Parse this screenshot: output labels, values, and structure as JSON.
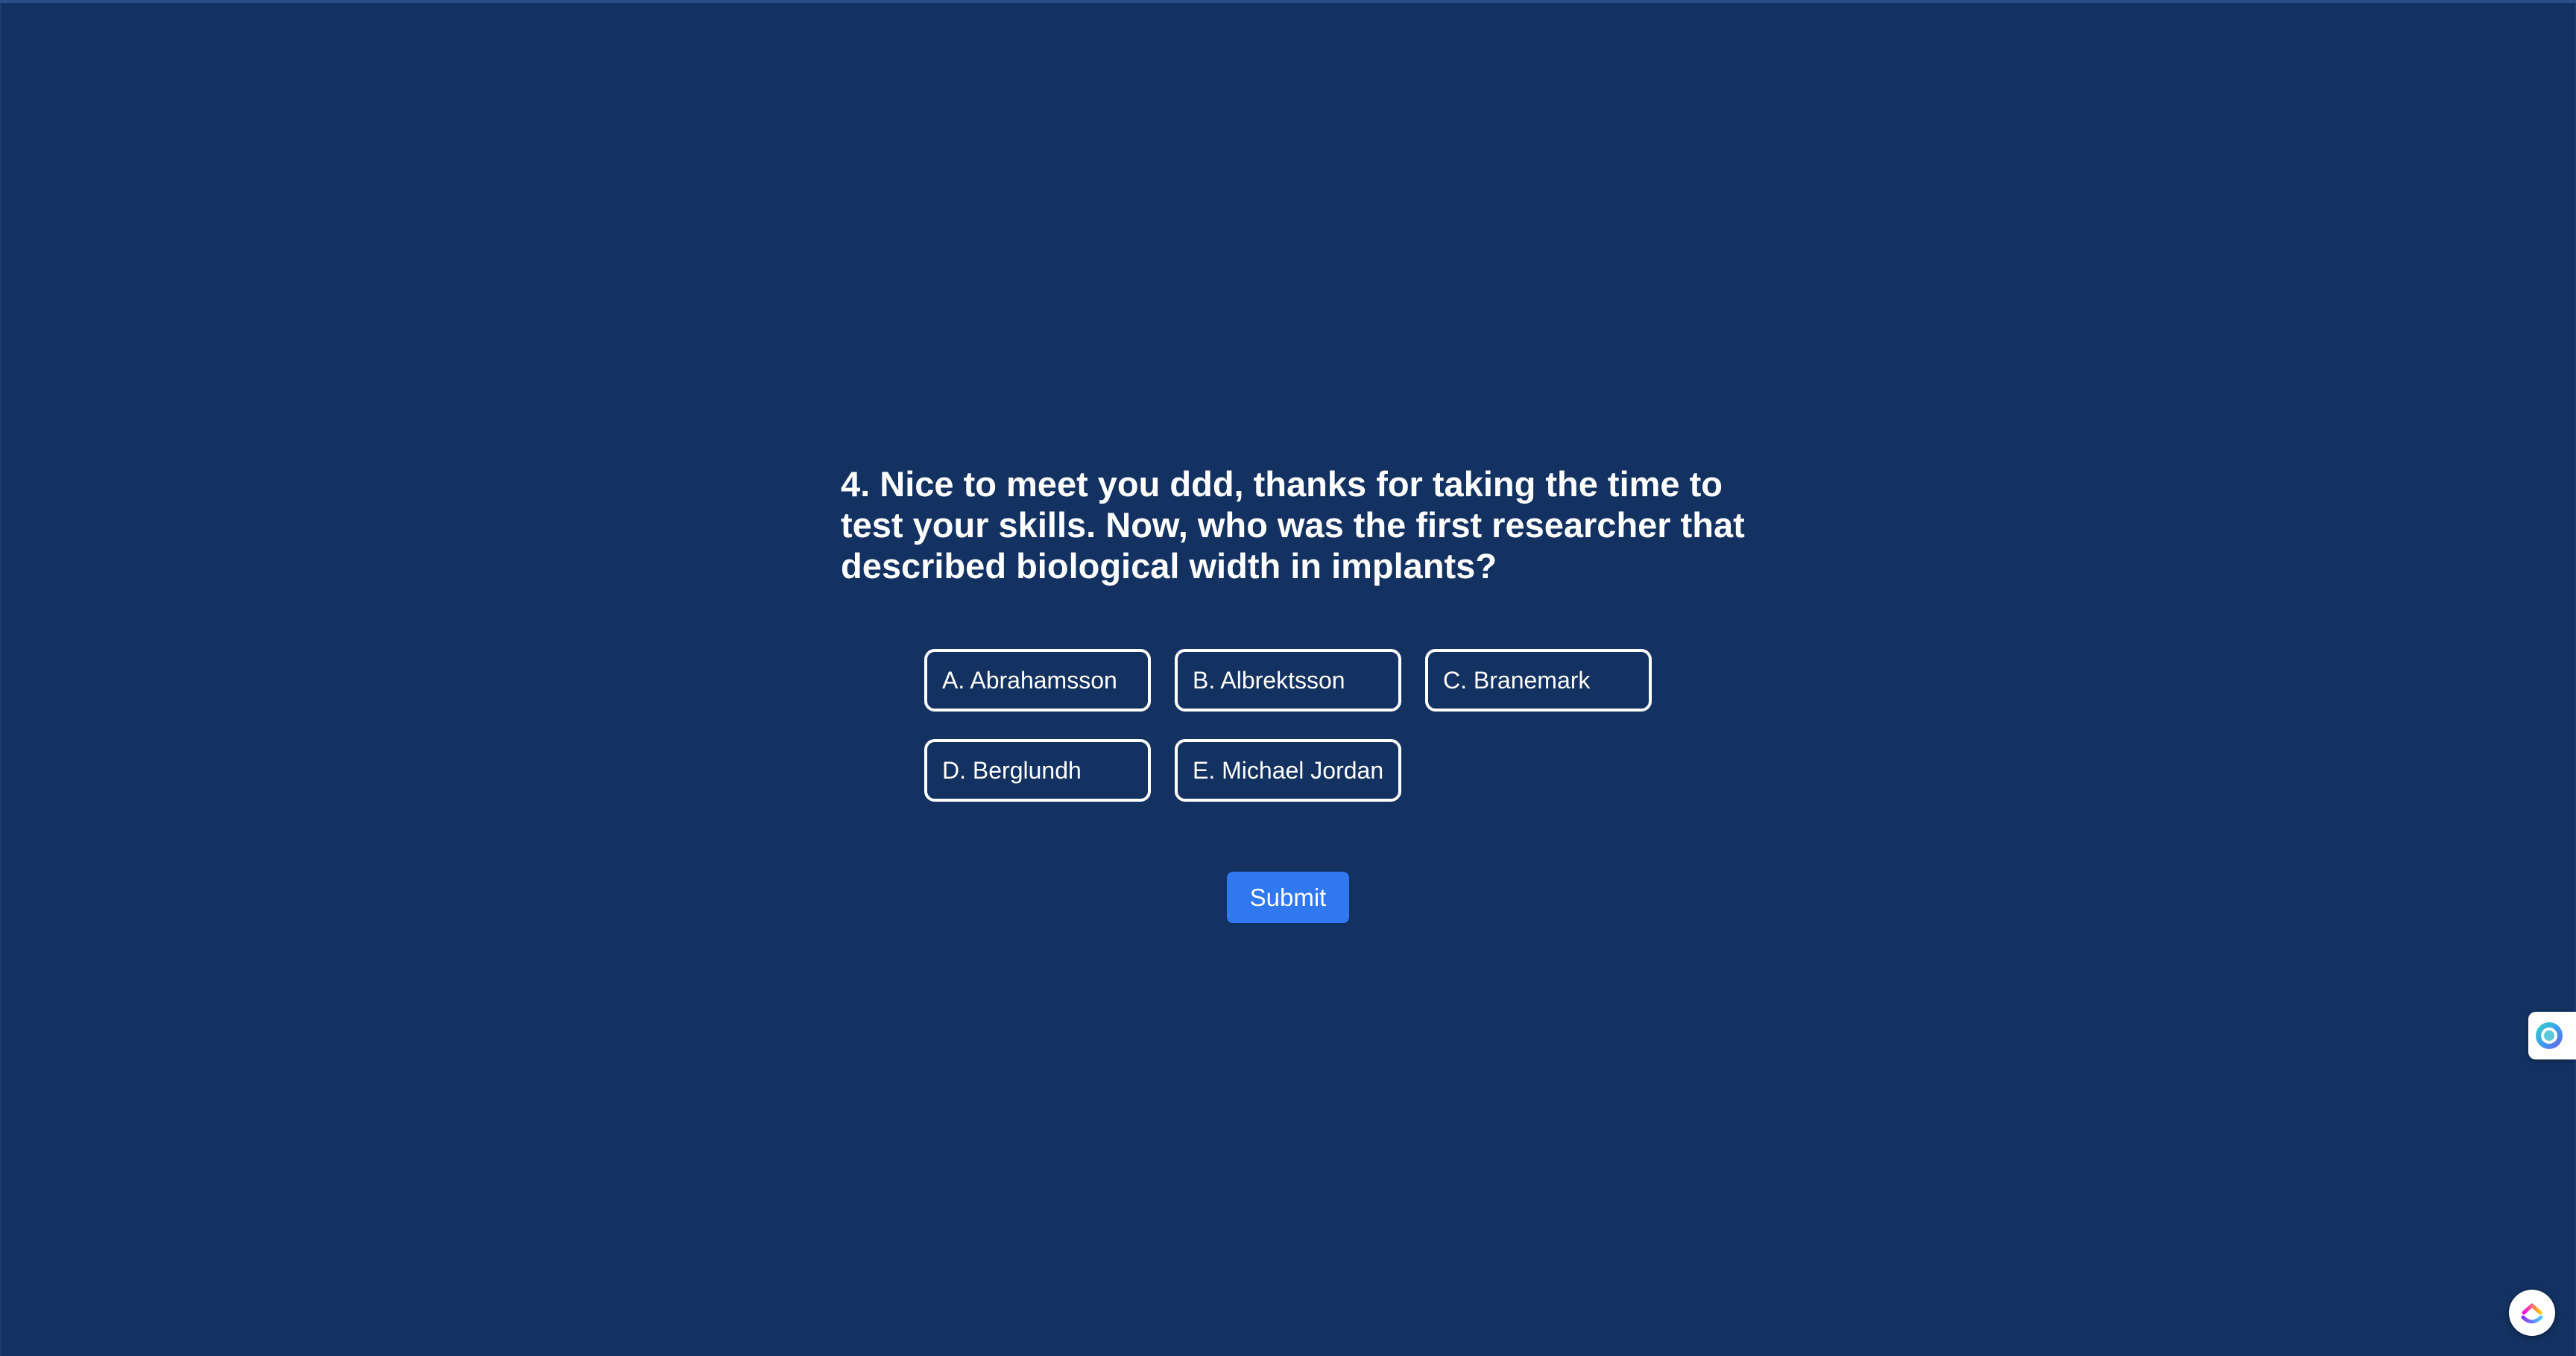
{
  "question": {
    "text": "4. Nice to meet you ddd, thanks for taking the time to test your skills. Now, who was the first researcher that described biological width in implants?"
  },
  "options": [
    {
      "label": "A. Abrahamsson"
    },
    {
      "label": "B. Albrektsson"
    },
    {
      "label": "C. Branemark"
    },
    {
      "label": "D. Berglundh"
    },
    {
      "label": "E. Michael Jordan"
    }
  ],
  "submit": {
    "label": "Submit"
  },
  "widgets": {
    "side_icon": "assistant-orb-icon",
    "launcher_icon": "clickup-logo-icon"
  },
  "colors": {
    "background": "#133262",
    "accent": "#2f78f0",
    "option_border": "#ffffff",
    "text": "#ffffff"
  }
}
